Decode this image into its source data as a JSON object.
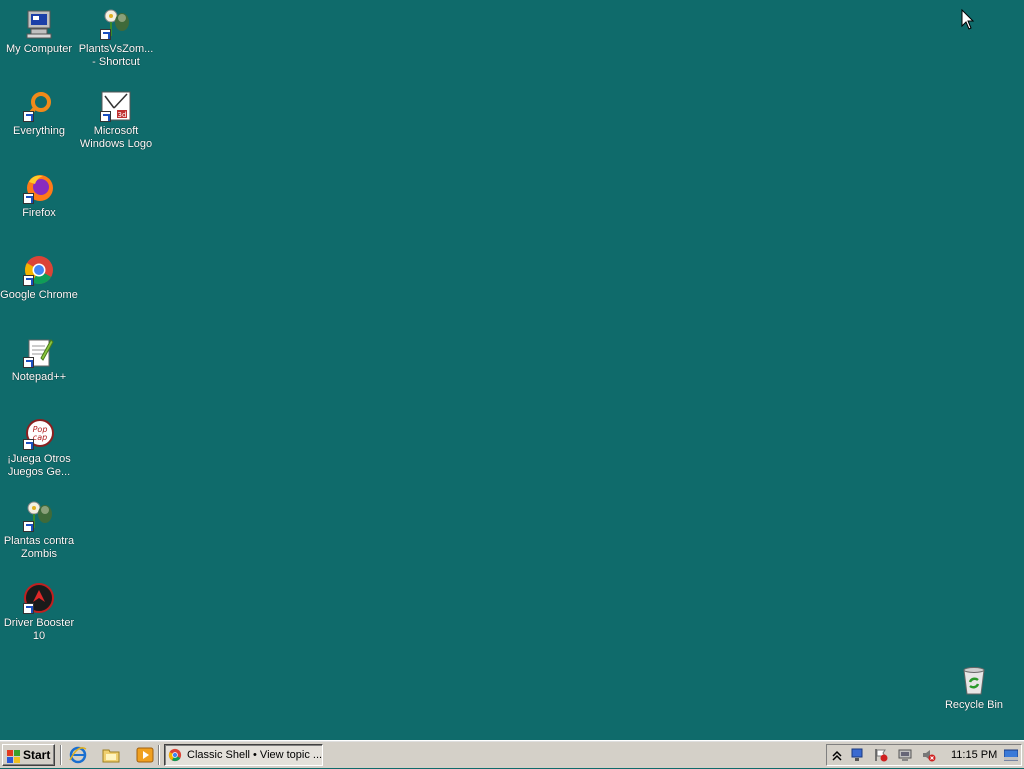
{
  "desktop": {
    "icons": [
      {
        "label": "My Computer"
      },
      {
        "label": "PlantsVsZom...\n- Shortcut"
      },
      {
        "label": "Everything"
      },
      {
        "label": "Microsoft\nWindows Logo"
      },
      {
        "label": "Firefox"
      },
      {
        "label": "Google Chrome"
      },
      {
        "label": "Notepad++"
      },
      {
        "label": "¡Juega Otros\nJuegos Ge..."
      },
      {
        "label": "Plantas contra\nZombis"
      },
      {
        "label": "Driver Booster\n10"
      },
      {
        "label": "Recycle Bin"
      }
    ],
    "background_color": "#0f6b6b"
  },
  "taskbar": {
    "start_label": "Start",
    "task_label": "Classic Shell • View topic ...",
    "clock": "11:15 PM",
    "quick_launch": [
      "ie-icon",
      "explorer-icon",
      "media-player-icon"
    ],
    "tray_icons": [
      "show-hidden-icon",
      "network-icon",
      "action-center-icon",
      "display-icon",
      "volume-muted-icon"
    ]
  }
}
